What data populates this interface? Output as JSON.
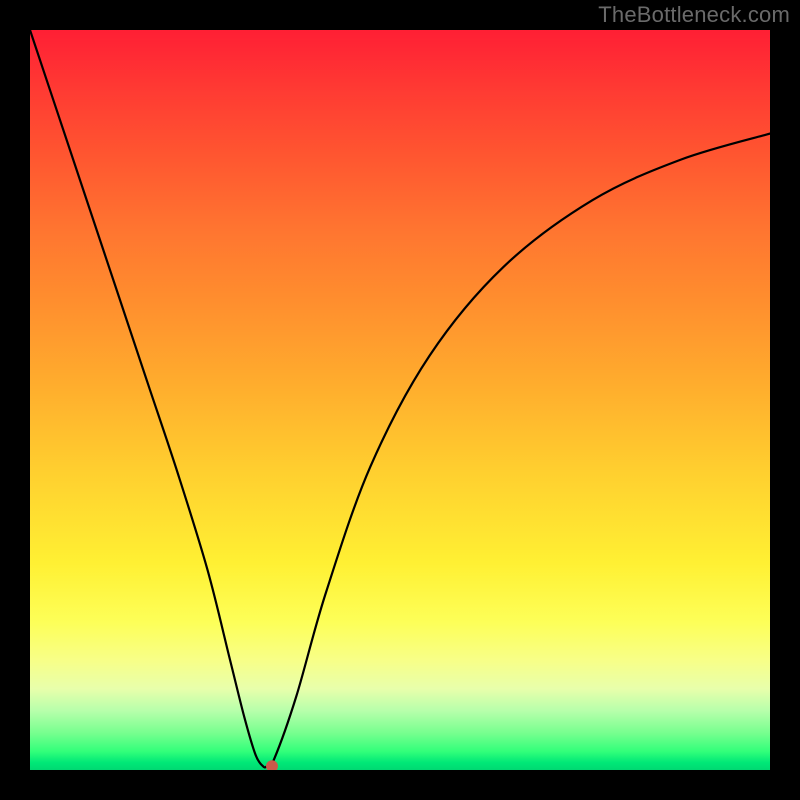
{
  "watermark": "TheBottleneck.com",
  "chart_data": {
    "type": "line",
    "title": "",
    "xlabel": "",
    "ylabel": "",
    "xlim": [
      0,
      100
    ],
    "ylim": [
      0,
      100
    ],
    "grid": false,
    "legend": false,
    "background_gradient": {
      "top": "#ff1f34",
      "mid": "#ffd02f",
      "bottom": "#00d872"
    },
    "series": [
      {
        "name": "bottleneck-curve",
        "x": [
          0,
          4,
          8,
          12,
          16,
          20,
          24,
          27,
          29,
          30.5,
          31.5,
          32,
          33,
          36,
          40,
          46,
          54,
          64,
          76,
          88,
          100
        ],
        "values": [
          100,
          88,
          76,
          64,
          52,
          40,
          27,
          15,
          7,
          2.0,
          0.5,
          0.5,
          1.5,
          10,
          24,
          41,
          56,
          68,
          77,
          82.5,
          86
        ]
      }
    ],
    "marker": {
      "x": 32.7,
      "y": 0.5,
      "color": "#c85a4a"
    }
  }
}
